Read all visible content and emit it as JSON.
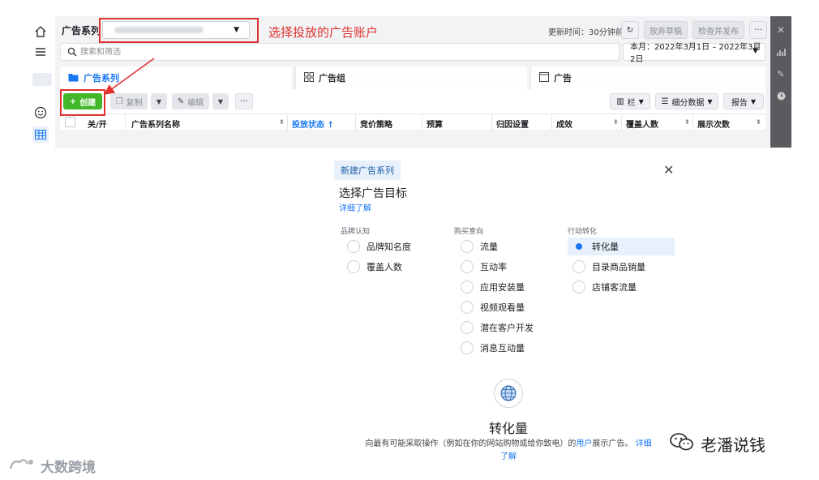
{
  "topbar": {
    "crumb": "广告系列",
    "annotation": "选择投放的广告账户",
    "updated": "更新时间：30分钟前",
    "discard_label": "放弃草稿",
    "publish_label": "检查并发布",
    "more_label": "···"
  },
  "search": {
    "placeholder": "搜索和筛选"
  },
  "daterange": {
    "label": "本月：2022年3月1日 – 2022年3月2日"
  },
  "tabs": [
    {
      "label": "广告系列"
    },
    {
      "label": "广告组"
    },
    {
      "label": "广告"
    }
  ],
  "toolbar": {
    "create_label": "创建",
    "copy_label": "复制",
    "edit_label": "编辑",
    "more_label": "···",
    "columns_label": "栏",
    "breakdown_label": "细分数据",
    "report_label": "报告"
  },
  "table": {
    "headers": [
      "关/开",
      "广告系列名称",
      "投放状态 ↑",
      "竞价策略",
      "预算",
      "归因设置",
      "成效",
      "覆盖人数",
      "展示次数"
    ]
  },
  "dialog": {
    "tag": "新建广告系列",
    "title": "选择广告目标",
    "learn_more": "详细了解",
    "groups": [
      {
        "label": "品牌认知",
        "options": [
          "品牌知名度",
          "覆盖人数"
        ]
      },
      {
        "label": "购买意向",
        "options": [
          "流量",
          "互动率",
          "应用安装量",
          "视频观看量",
          "潜在客户开发",
          "消息互动量"
        ]
      },
      {
        "label": "行动转化",
        "options": [
          "转化量",
          "目录商品销量",
          "店铺客流量"
        ]
      }
    ],
    "selected": "转化量",
    "detail_title": "转化量",
    "detail_desc_1": "向最有可能采取操作（例如在你的网站购物或给你致电）的",
    "detail_desc_link": "用户",
    "detail_desc_2": "展示广告。",
    "detail_learn_more": "详细了解"
  },
  "watermarks": {
    "left": "大数跨境",
    "right": "老潘说钱"
  }
}
